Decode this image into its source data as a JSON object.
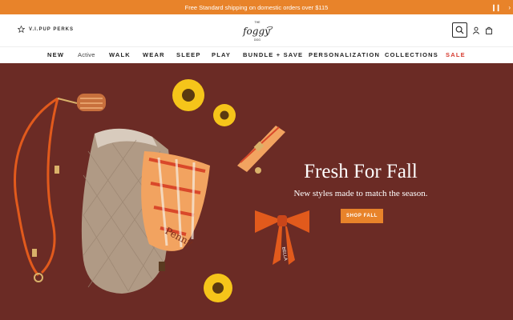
{
  "announcement": {
    "text": "Free Standard shipping on domestic orders over $115",
    "pause_icon": "pause-icon",
    "next_icon": "chevron-right-icon"
  },
  "header": {
    "vip_label": "V.I.PUP PERKS",
    "vip_icon": "star-icon",
    "logo_text_top": "THE",
    "logo_text_main": "foggy",
    "logo_text_bottom": "DOG",
    "icons": [
      "search-icon",
      "user-icon",
      "bag-icon"
    ]
  },
  "nav": {
    "items": [
      {
        "label": "NEW"
      },
      {
        "label": "Active"
      },
      {
        "label": "WALK"
      },
      {
        "label": "WEAR"
      },
      {
        "label": "SLEEP"
      },
      {
        "label": "PLAY"
      },
      {
        "label": "BUNDLE + SAVE"
      },
      {
        "label": "PERSONALIZATION"
      },
      {
        "label": "COLLECTIONS"
      },
      {
        "label": "SALE"
      }
    ]
  },
  "hero": {
    "title": "Fresh For Fall",
    "subtitle": "New styles made to match the season.",
    "cta_label": "SHOP FALL",
    "bandana_name": "Penny",
    "bow_name": "BELLA",
    "colors": {
      "background": "#6b2b25",
      "accent": "#e8832a"
    }
  }
}
